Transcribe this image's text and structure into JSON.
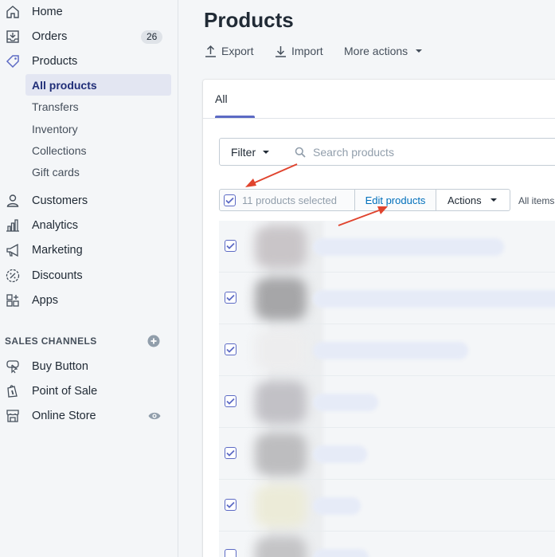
{
  "sidebar": {
    "items": [
      {
        "label": "Home",
        "icon": "home-icon"
      },
      {
        "label": "Orders",
        "icon": "orders-icon",
        "badge": "26"
      },
      {
        "label": "Products",
        "icon": "tag-icon"
      }
    ],
    "product_sub": [
      {
        "label": "All products",
        "active": true
      },
      {
        "label": "Transfers"
      },
      {
        "label": "Inventory"
      },
      {
        "label": "Collections"
      },
      {
        "label": "Gift cards"
      }
    ],
    "items2": [
      {
        "label": "Customers",
        "icon": "person-icon"
      },
      {
        "label": "Analytics",
        "icon": "bar-chart-icon"
      },
      {
        "label": "Marketing",
        "icon": "megaphone-icon"
      },
      {
        "label": "Discounts",
        "icon": "discount-icon"
      },
      {
        "label": "Apps",
        "icon": "apps-icon"
      }
    ],
    "sales_channels_title": "SALES CHANNELS",
    "channels": [
      {
        "label": "Buy Button",
        "icon": "buy-button-icon"
      },
      {
        "label": "Point of Sale",
        "icon": "pos-bag-icon"
      },
      {
        "label": "Online Store",
        "icon": "store-icon"
      }
    ]
  },
  "page": {
    "title": "Products",
    "actions": {
      "export": "Export",
      "import": "Import",
      "more": "More actions"
    }
  },
  "card": {
    "tab_all": "All",
    "filter_label": "Filter",
    "search_placeholder": "Search products",
    "bulk": {
      "selected_text": "11 products selected",
      "edit_products": "Edit products",
      "actions": "Actions",
      "all_items": "All items"
    }
  },
  "colors": {
    "accent": "#5c6ac4",
    "link": "#006fbb",
    "annotation_arrow": "#e0442e"
  }
}
